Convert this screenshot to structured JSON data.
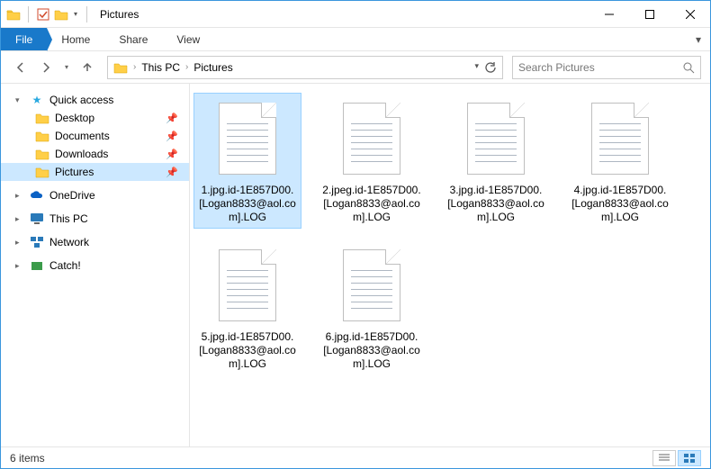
{
  "title": "Pictures",
  "ribbon": {
    "file": "File",
    "tabs": [
      "Home",
      "Share",
      "View"
    ]
  },
  "breadcrumbs": [
    "This PC",
    "Pictures"
  ],
  "search": {
    "placeholder": "Search Pictures"
  },
  "sidebar": {
    "quick_access": {
      "label": "Quick access",
      "items": [
        {
          "label": "Desktop",
          "pinned": true
        },
        {
          "label": "Documents",
          "pinned": true
        },
        {
          "label": "Downloads",
          "pinned": true
        },
        {
          "label": "Pictures",
          "pinned": true,
          "selected": true
        }
      ]
    },
    "others": [
      {
        "label": "OneDrive"
      },
      {
        "label": "This PC"
      },
      {
        "label": "Network"
      },
      {
        "label": "Catch!"
      }
    ]
  },
  "files": [
    {
      "name": "1.jpg.id-1E857D00.[Logan8833@aol.com].LOG",
      "selected": true
    },
    {
      "name": "2.jpeg.id-1E857D00.[Logan8833@aol.com].LOG"
    },
    {
      "name": "3.jpg.id-1E857D00.[Logan8833@aol.com].LOG"
    },
    {
      "name": "4.jpg.id-1E857D00.[Logan8833@aol.com].LOG"
    },
    {
      "name": "5.jpg.id-1E857D00.[Logan8833@aol.com].LOG"
    },
    {
      "name": "6.jpg.id-1E857D00.[Logan8833@aol.com].LOG"
    }
  ],
  "status": {
    "count": "6 items"
  }
}
